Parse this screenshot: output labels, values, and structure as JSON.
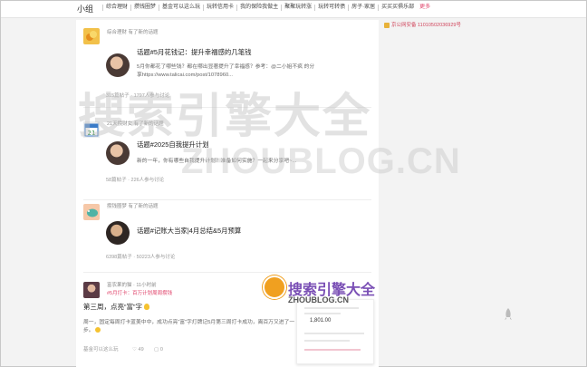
{
  "topbar": {
    "brand": "小组",
    "nav": [
      "综合理财",
      "攒钱圈梦",
      "基金可以这么玩",
      "玩转信用卡",
      "我的保险我做主",
      "聚聚玩转涨",
      "玩转可转债",
      "房子·家居",
      "买买买俱乐部"
    ],
    "more": "更多"
  },
  "sidebar": {
    "badge_text": "京公网安备 11010502036929号"
  },
  "posts": [
    {
      "group": "综合理财",
      "group_action": "有了新的话题",
      "title": "话题#5月花钱记：提升幸福感的几笔钱",
      "excerpt": "5月你都花了哪些钱？都在哪出显著提升了幸福感？参考：@二小姐不疯 的分享https://www.talicai.com/post/1078960...",
      "stats": "315篇帖子 · 1797人参与讨论"
    },
    {
      "group": "21天攒财女",
      "group_action": "有了新的话题",
      "title": "话题#2025自我提升计划",
      "excerpt": "新的一年，你有哪些自我提升计划？准备如何实施？一起来分享吧~...",
      "stats": "58篇帖子 · 226人参与讨论"
    },
    {
      "group": "攒钱圈梦",
      "group_action": "有了新的话题",
      "title": "话题#记账大当家|4月总结&5月预算",
      "excerpt": "",
      "stats": "6398篇帖子 · 50223人参与讨论"
    }
  ],
  "last_post": {
    "author": "富农果的猫",
    "time": "· 11小时前",
    "tag": "#5月打卡：百万计划周周攒钱",
    "title": "第三周，点亮“富”字",
    "excerpt": "周一，固定每周打卡蓝美中中，成功点亮“富”字灯牌记5月第三周打卡成功，离百万又进了一步。",
    "group": "基金可以这么玩",
    "likes": "49",
    "comments": "0"
  },
  "watermark": {
    "big": "搜索引擎大全",
    "domain": "ZHOUBLOG.CN",
    "small": "搜索引擎大全",
    "small_domain": "ZHOUBLOG.CN",
    "card_value": "1,801.00"
  },
  "colors": {
    "accent": "#e0446b",
    "watermark": "#cfcfcf"
  }
}
